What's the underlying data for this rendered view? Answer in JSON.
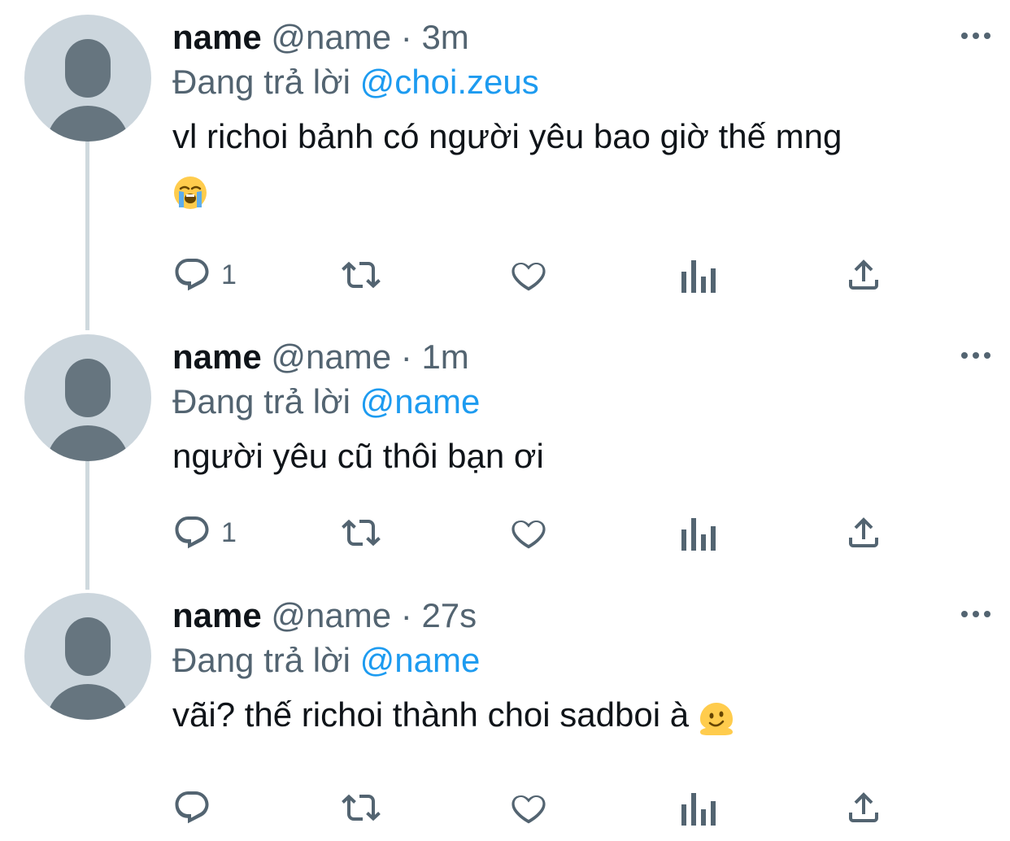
{
  "tweets": [
    {
      "display_name": "name",
      "handle": "@name",
      "separator": "·",
      "time": "3m",
      "replying_prefix": "Đang trả lời",
      "replying_to": "@choi.zeus",
      "text": "vl richoi bảnh có người yêu bao giờ thế mng",
      "emoji": "loudly-crying-face",
      "reply_count": "1",
      "retweet_count": "",
      "like_count": "",
      "view_count": ""
    },
    {
      "display_name": "name",
      "handle": "@name",
      "separator": "·",
      "time": "1m",
      "replying_prefix": "Đang trả lời",
      "replying_to": "@name",
      "text": "người yêu cũ thôi bạn ơi",
      "emoji": "",
      "reply_count": "1",
      "retweet_count": "",
      "like_count": "",
      "view_count": ""
    },
    {
      "display_name": "name",
      "handle": "@name",
      "separator": "·",
      "time": "27s",
      "replying_prefix": "Đang trả lời",
      "replying_to": "@name",
      "text": "vãi? thế richoi thành choi sadboi à",
      "emoji": "melting-face",
      "reply_count": "",
      "retweet_count": "",
      "like_count": "",
      "view_count": ""
    }
  ],
  "icons": {
    "more": "more-horizontal-icon",
    "reply": "reply-bubble-icon",
    "retweet": "retweet-icon",
    "like": "heart-icon",
    "views": "analytics-bars-icon",
    "share": "share-upload-icon"
  },
  "colors": {
    "text_primary": "#0f1419",
    "text_secondary": "#536471",
    "mention": "#1d9bf0",
    "avatar_bg": "#ccd6dd",
    "avatar_fg": "#66757f",
    "thread_line": "#cfd9de",
    "icon": "#536471"
  }
}
